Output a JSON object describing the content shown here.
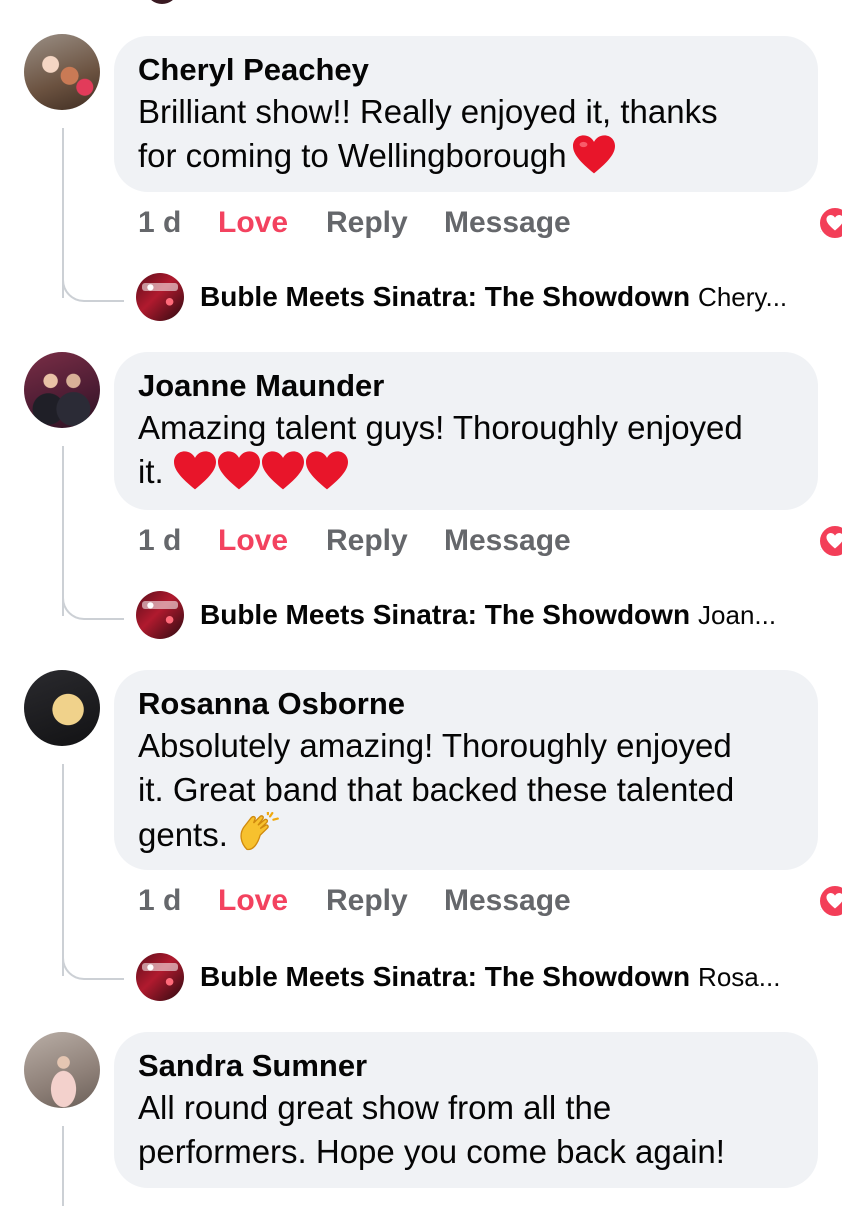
{
  "comments": [
    {
      "author": "Cheryl Peachey",
      "lines": [
        "Brilliant show!! Really enjoyed it, thanks",
        "for coming to Wellingborough"
      ],
      "emoji": "red-heart",
      "time": "1 d",
      "love_label": "Love",
      "reply_label": "Reply",
      "message_label": "Message",
      "reaction_count": "1",
      "reply_page": "Buble Meets Sinatra: The Showdown",
      "reply_snippet": "Chery..."
    },
    {
      "author": "Joanne Maunder",
      "lines": [
        "Amazing talent guys!  Thoroughly enjoyed",
        "it."
      ],
      "emoji": "red-heart x4",
      "time": "1 d",
      "love_label": "Love",
      "reply_label": "Reply",
      "message_label": "Message",
      "reaction_count": "1",
      "reply_page": "Buble Meets Sinatra: The Showdown",
      "reply_snippet": "Joan..."
    },
    {
      "author": "Rosanna Osborne",
      "lines": [
        "Absolutely amazing! Thoroughly enjoyed",
        "it. Great band that backed these talented",
        "gents."
      ],
      "emoji": "clapping-hands",
      "time": "1 d",
      "love_label": "Love",
      "reply_label": "Reply",
      "message_label": "Message",
      "reaction_count": "1",
      "reply_page": "Buble Meets Sinatra: The Showdown",
      "reply_snippet": "Rosa..."
    },
    {
      "author": "Sandra Sumner",
      "lines": [
        "All round great show from all the",
        "performers.  Hope you come back again!"
      ]
    }
  ],
  "colors": {
    "bubble": "#f0f2f5",
    "love": "#f3425f",
    "secondary_text": "#65676b",
    "thread_line": "#ccd0d5"
  }
}
